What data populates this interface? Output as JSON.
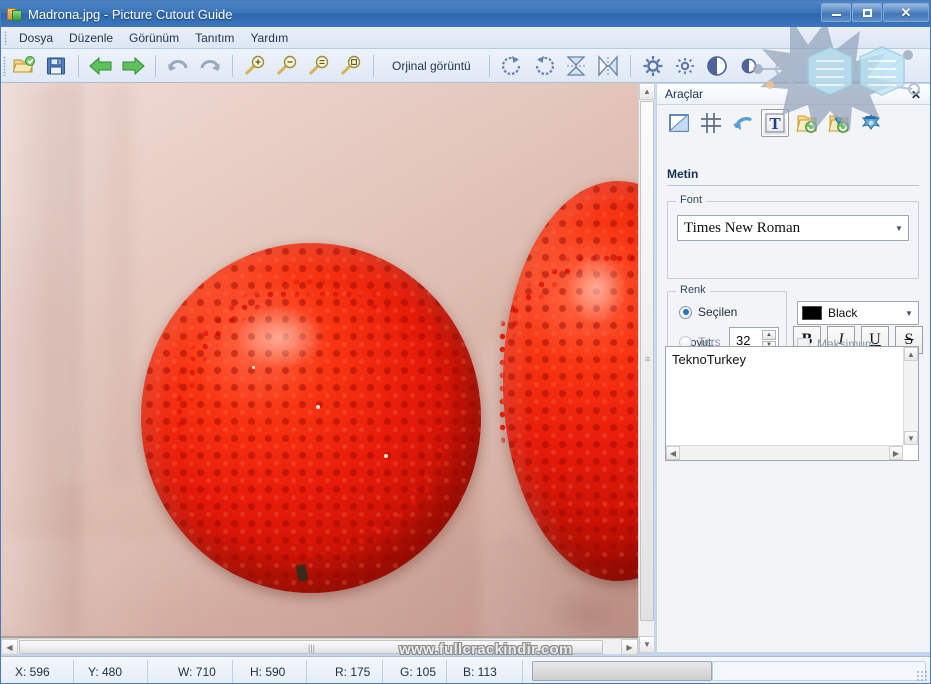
{
  "window": {
    "title": "Madrona.jpg - Picture Cutout Guide",
    "app_icon": "picture-cutout-guide-icon",
    "buttons": {
      "minimize": "minimize-icon",
      "maximize": "maximize-icon",
      "close": "close-icon"
    }
  },
  "menu": {
    "items": [
      {
        "label": "Dosya",
        "name": "menu-dosya"
      },
      {
        "label": "Düzenle",
        "name": "menu-duzenle"
      },
      {
        "label": "Görünüm",
        "name": "menu-gorunum"
      },
      {
        "label": "Tanıtım",
        "name": "menu-tanitim"
      },
      {
        "label": "Yardım",
        "name": "menu-yardim"
      }
    ]
  },
  "toolbar": {
    "original_image_label": "Orjinal görüntü",
    "buttons": [
      {
        "name": "open-file-icon",
        "title": "Aç"
      },
      {
        "name": "save-file-icon",
        "title": "Kaydet"
      },
      {
        "name": "back-arrow-icon",
        "title": "Geri"
      },
      {
        "name": "forward-arrow-icon",
        "title": "İleri"
      },
      {
        "name": "undo-icon",
        "title": "Geri al"
      },
      {
        "name": "redo-icon",
        "title": "Yinele"
      },
      {
        "name": "zoom-in-icon",
        "title": "Yakınlaştır"
      },
      {
        "name": "zoom-out-icon",
        "title": "Uzaklaştır"
      },
      {
        "name": "zoom-fit-icon",
        "title": "Sığdır"
      },
      {
        "name": "zoom-actual-icon",
        "title": "Gerçek boyut"
      },
      {
        "name": "rotate-cw-icon",
        "title": "Sağa döndür"
      },
      {
        "name": "rotate-ccw-icon",
        "title": "Sola döndür"
      },
      {
        "name": "flip-vertical-icon",
        "title": "Dikey çevir"
      },
      {
        "name": "flip-horizontal-icon",
        "title": "Yatay çevir"
      },
      {
        "name": "brightness-up-icon",
        "title": "Parlaklık +"
      },
      {
        "name": "brightness-down-icon",
        "title": "Parlaklık -"
      },
      {
        "name": "contrast-up-icon",
        "title": "Kontrast +"
      },
      {
        "name": "contrast-down-icon",
        "title": "Kontrast -"
      }
    ]
  },
  "canvas": {
    "watermark": "www.fullcrackindir.com",
    "image_alt": "Madrona berries held in fingers"
  },
  "tools_panel": {
    "header": "Araçlar",
    "close_label": "✕",
    "tool_icons": [
      {
        "name": "crop-resize-tool-icon",
        "selected": false
      },
      {
        "name": "guides-grid-tool-icon",
        "selected": false
      },
      {
        "name": "undo-curve-tool-icon",
        "selected": false
      },
      {
        "name": "text-tool-icon",
        "selected": true
      },
      {
        "name": "batch-folder-tool-icon",
        "selected": false
      },
      {
        "name": "batch-folder-convert-tool-icon",
        "selected": false
      },
      {
        "name": "effects-splat-tool-icon",
        "selected": false
      }
    ],
    "section_title": "Metin",
    "font_group": {
      "legend": "Font",
      "font_name": "Times New Roman",
      "size_label": "Boyut:",
      "size_value": "32",
      "style_buttons": [
        {
          "label": "B",
          "name": "bold-button"
        },
        {
          "label": "I",
          "name": "italic-button"
        },
        {
          "label": "U",
          "name": "underline-button"
        },
        {
          "label": "S",
          "name": "strikethrough-button"
        }
      ]
    },
    "color_group": {
      "legend": "Renk",
      "radio_selected_label": "Seçilen",
      "radio_inverse_label": "Ters",
      "color_name": "Black",
      "color_hex": "#000000",
      "maximum_label": "Maksimum"
    },
    "text_input": {
      "value": "TeknoTurkey",
      "placeholder": ""
    }
  },
  "statusbar": {
    "cells": [
      {
        "name": "status-x",
        "label": "X: 596"
      },
      {
        "name": "status-y",
        "label": "Y: 480"
      },
      {
        "name": "status-w",
        "label": "W: 710"
      },
      {
        "name": "status-h",
        "label": "H: 590"
      },
      {
        "name": "status-r",
        "label": "R: 175"
      },
      {
        "name": "status-g",
        "label": "G: 105"
      },
      {
        "name": "status-b",
        "label": "B: 113"
      }
    ]
  },
  "colors": {
    "titlebar": "#3c74ba",
    "accent": "#2b6fc4",
    "berry_red": "#e81b0a",
    "skin": "#dfbfb4"
  }
}
